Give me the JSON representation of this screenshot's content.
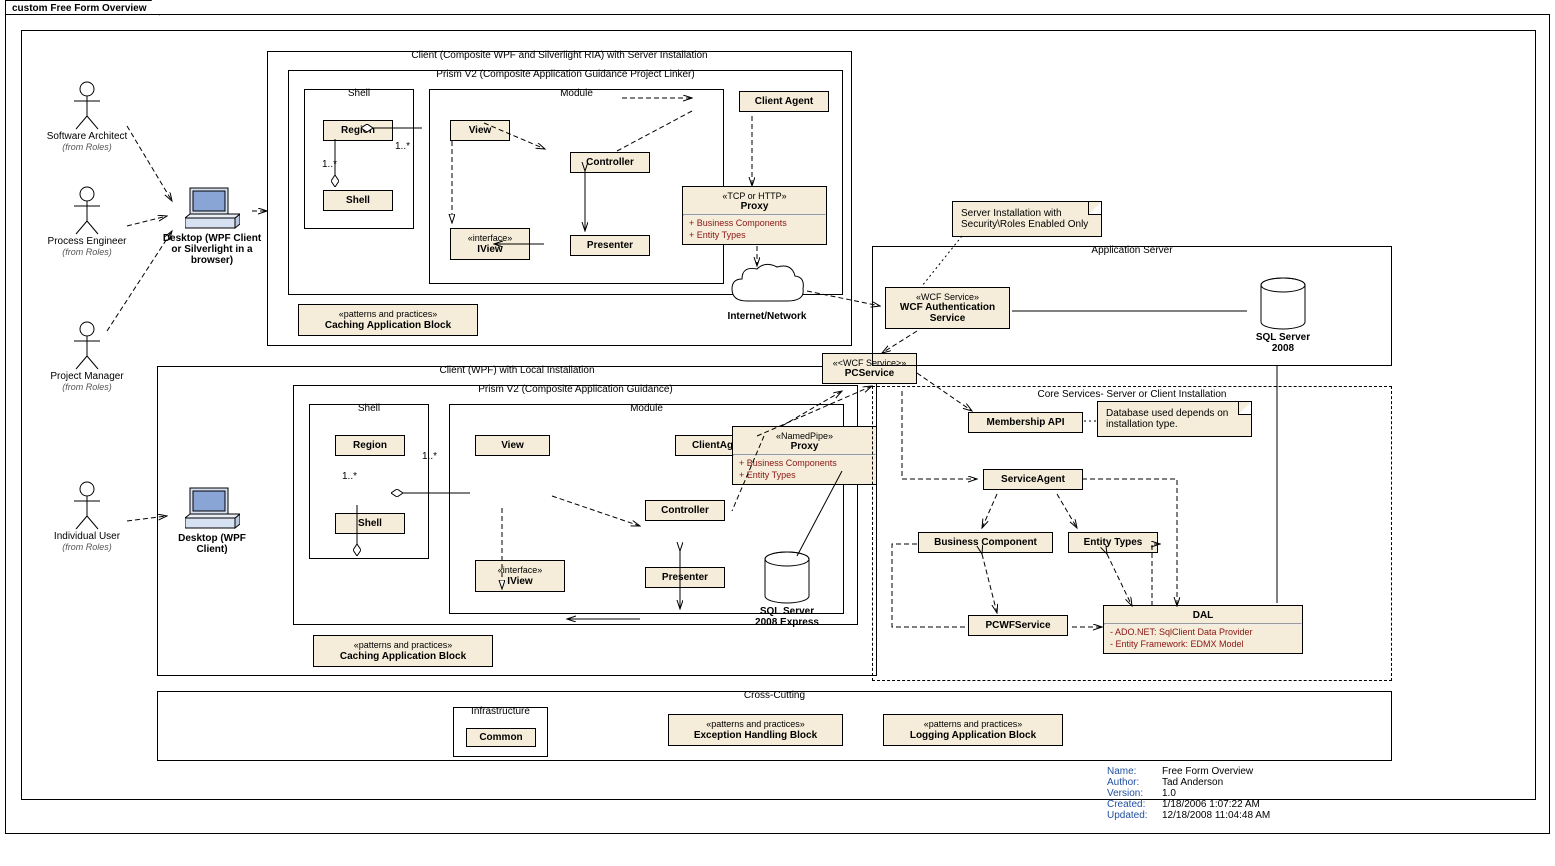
{
  "tab": "custom Free Form Overview",
  "actors": {
    "a1": {
      "name": "Software Architect",
      "from": "(from Roles)"
    },
    "a2": {
      "name": "Process Engineer",
      "from": "(from Roles)"
    },
    "a3": {
      "name": "Project Manager",
      "from": "(from Roles)"
    },
    "a4": {
      "name": "Individual User",
      "from": "(from Roles)"
    }
  },
  "desktops": {
    "d1": "Desktop (WPF Client or Silverlight in a browser)",
    "d2": "Desktop (WPF Client)"
  },
  "client1": {
    "title": "Client (Composite WPF and Silverlight RIA) with Server Installation",
    "prism": "Prism V2 (Composite Application Guidance Project Linker)",
    "shell": "Shell",
    "module": "Module",
    "region": "Region",
    "shellBox": "Shell",
    "view": "View",
    "iview_st": "«interface»",
    "iview": "IView",
    "presenter": "Presenter",
    "controller": "Controller",
    "agent": "Client Agent",
    "mult": "1..*",
    "cache_st": "«patterns and practices»",
    "cache": "Caching Application Block"
  },
  "client2": {
    "title": "Client (WPF) with Local Installation",
    "prism": "Prism V2 (Composite Application Guidance)",
    "shell": "Shell",
    "module": "Module",
    "region": "Region",
    "shellBox": "Shell",
    "view": "View",
    "iview_st": "«interface»",
    "iview": "IView",
    "presenter": "Presenter",
    "controller": "Controller",
    "agent": "ClientAgent",
    "mult": "1..*",
    "cache_st": "«patterns and practices»",
    "cache": "Caching Application Block"
  },
  "proxy1": {
    "st": "«TCP or HTTP»",
    "nm": "Proxy",
    "f1": "+   Business Components",
    "f2": "+   Entity Types"
  },
  "proxy2": {
    "st": "«NamedPipe»",
    "nm": "Proxy",
    "f1": "+   Business Components",
    "f2": "+   Entity Types"
  },
  "cloud": "Internet/Network",
  "sqle": "SQL Server 2008 Express",
  "appserver": {
    "title": "Application Server",
    "wcfAuth_st": "«WCF Service»",
    "wcfAuth": "WCF Authentication Service",
    "sql": "SQL Server 2008"
  },
  "pcservice": {
    "st": "«<WCF Service>»",
    "nm": "PCService"
  },
  "note_server": "Server Installation with Security\\Roles Enabled Only",
  "note_db": "Database used depends on installation type.",
  "core": {
    "title": "Core Services- Server or Client Installation",
    "membership": "Membership API",
    "serviceAgent": "ServiceAgent",
    "bc": "Business Component",
    "et": "Entity Types",
    "pcwf": "PCWFService",
    "dal": "DAL",
    "dal_f1": "-   ADO.NET:  SqlClient Data Provider",
    "dal_f2": "-   Entity Framework:  EDMX Model"
  },
  "cross": {
    "title": "Cross-Cutting",
    "infra_t": "Infrastructure",
    "infra": "Common",
    "ex_st": "«patterns and practices»",
    "ex": "Exception Handling Block",
    "log_st": "«patterns and practices»",
    "log": "Logging Application Block"
  },
  "meta": {
    "name": {
      "l": "Name:",
      "v": "Free Form Overview"
    },
    "author": {
      "l": "Author:",
      "v": "Tad Anderson"
    },
    "version": {
      "l": "Version:",
      "v": "1.0"
    },
    "created": {
      "l": "Created:",
      "v": "1/18/2006 1:07:22 AM"
    },
    "updated": {
      "l": "Updated:",
      "v": "12/18/2008 11:04:48 AM"
    }
  }
}
